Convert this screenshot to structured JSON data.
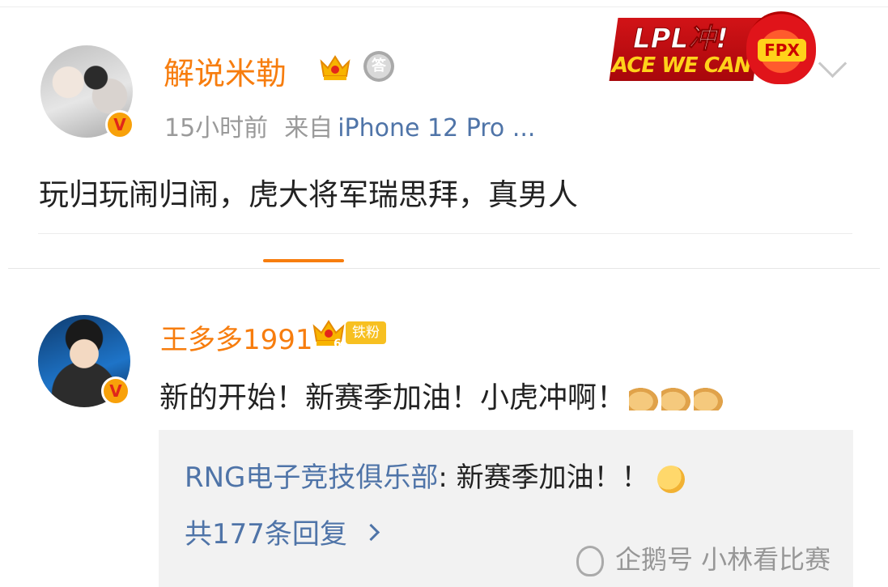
{
  "post": {
    "username": "解说米勒",
    "medal_char": "答",
    "time": "15小时前",
    "from_label": "来自",
    "source": "iPhone 12 Pro ...",
    "text": "玩归玩闹归闹，虎大将军瑞思拜，真男人",
    "verified_mark": "V"
  },
  "banner": {
    "top_text": "LPL冲!",
    "bottom_text": "ACE WE CAN",
    "team": "FPX"
  },
  "reply": {
    "username": "王多多1991",
    "crown_level": "6",
    "fan_tag": "铁粉",
    "verified_mark": "V",
    "text": "新的开始！新赛季加油！小虎冲啊！",
    "emoji": [
      "flexed-biceps",
      "flexed-biceps",
      "flexed-biceps"
    ],
    "quoted": {
      "user": "RNG电子竞技俱乐部",
      "text": ": 新赛季加油！！",
      "emoji": "smiling-face-with-hearts"
    },
    "reply_count_label": "共177条回复"
  },
  "watermark": {
    "text": "企鹅号 小林看比赛"
  },
  "colors": {
    "username": "#f77d0e",
    "link": "#4f74a8",
    "meta": "#9a9a9a",
    "quote_bg": "#f2f2f2"
  }
}
